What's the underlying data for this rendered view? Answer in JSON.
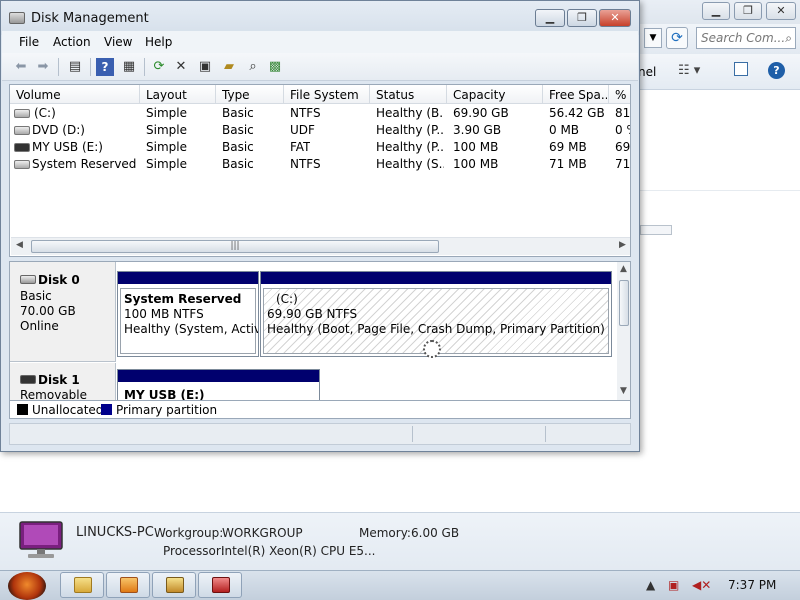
{
  "background_window": {
    "search_placeholder": "Search Com...",
    "nav_label": "nel",
    "computer_name": "LINUCKS-PC",
    "workgroup_label": "Workgroup:",
    "workgroup": "WORKGROUP",
    "memory_label": "Memory:",
    "memory": "6.00 GB",
    "processor_label": "Processor:",
    "processor": "Intel(R) Xeon(R) CPU E5..."
  },
  "window": {
    "title": "Disk Management"
  },
  "menu": [
    "File",
    "Action",
    "View",
    "Help"
  ],
  "volume_list": {
    "columns": [
      "Volume",
      "Layout",
      "Type",
      "File System",
      "Status",
      "Capacity",
      "Free Spa...",
      "% F"
    ],
    "rows": [
      [
        "(C:)",
        "Simple",
        "Basic",
        "NTFS",
        "Healthy (B...",
        "69.90 GB",
        "56.42 GB",
        "81"
      ],
      [
        "DVD (D:)",
        "Simple",
        "Basic",
        "UDF",
        "Healthy (P...",
        "3.90 GB",
        "0 MB",
        "0 %"
      ],
      [
        "MY USB (E:)",
        "Simple",
        "Basic",
        "FAT",
        "Healthy (P...",
        "100 MB",
        "69 MB",
        "69"
      ],
      [
        "System Reserved",
        "Simple",
        "Basic",
        "NTFS",
        "Healthy (S...",
        "100 MB",
        "71 MB",
        "71"
      ]
    ],
    "scroll_grip": "|||"
  },
  "disks": [
    {
      "name": "Disk 0",
      "type": "Basic",
      "size": "70.00 GB",
      "state": "Online",
      "partitions": [
        {
          "name": "System Reserved",
          "fs": "100 MB NTFS",
          "status": "Healthy (System, Active,"
        },
        {
          "name": "(C:)",
          "fs": "69.90 GB NTFS",
          "status": "Healthy (Boot, Page File, Crash Dump, Primary Partition)"
        }
      ]
    },
    {
      "name": "Disk 1",
      "type": "Removable",
      "partitions": [
        {
          "name": "MY USB  (E:)"
        }
      ]
    }
  ],
  "legend": [
    {
      "label": "Unallocated",
      "color": "#000000"
    },
    {
      "label": "Primary partition",
      "color": "#00008b"
    }
  ],
  "taskbar": {
    "clock": "7:37 PM"
  }
}
